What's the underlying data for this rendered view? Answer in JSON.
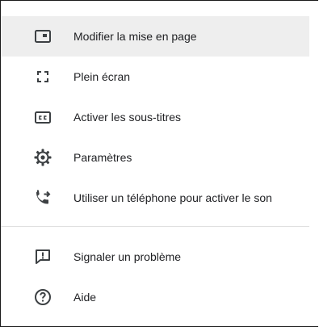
{
  "menu": {
    "items": [
      {
        "label": "Modifier la mise en page",
        "icon": "layout-icon"
      },
      {
        "label": "Plein écran",
        "icon": "fullscreen-icon"
      },
      {
        "label": "Activer les sous-titres",
        "icon": "closed-captions-icon"
      },
      {
        "label": "Paramètres",
        "icon": "gear-icon"
      },
      {
        "label": "Utiliser un téléphone pour activer le son",
        "icon": "phone-forward-icon"
      },
      {
        "label": "Signaler un problème",
        "icon": "report-problem-icon"
      },
      {
        "label": "Aide",
        "icon": "help-icon"
      }
    ]
  },
  "colors": {
    "text": "#202124",
    "icon": "#3c4043",
    "hover_background": "#eeeeee",
    "divider": "#e0e0e0",
    "border": "#1a1a1a"
  }
}
